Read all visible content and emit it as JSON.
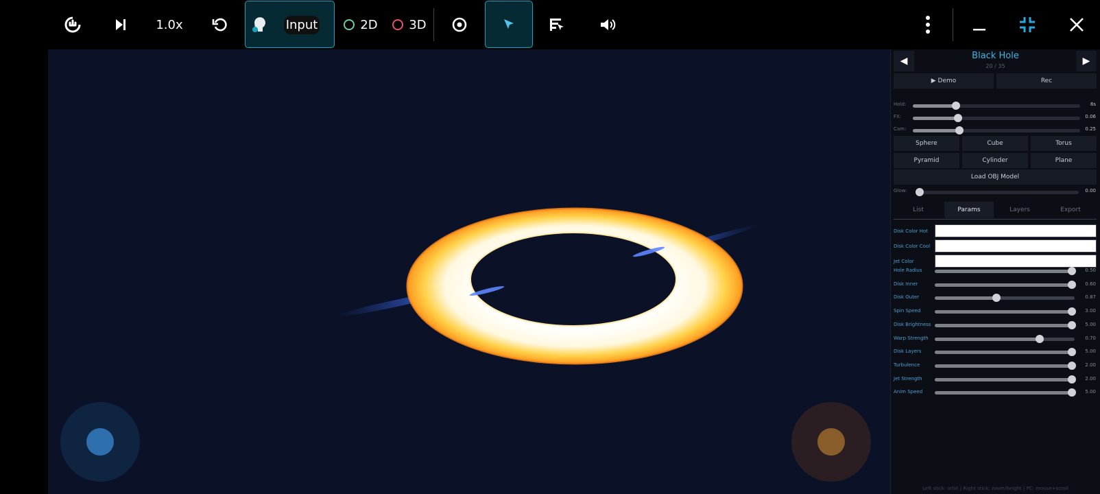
{
  "toolbar": {
    "speed_label": "1.0x",
    "input_label": "Input",
    "mode_2d_label": "2D",
    "mode_3d_label": "3D",
    "colors": {
      "accent": "#17a3c0",
      "ring_2d": "#6fd0a0",
      "ring_3d": "#e2556a"
    }
  },
  "viewport": {
    "left_joystick_color": "#2e6fae",
    "right_joystick_color": "#8a5e2a"
  },
  "panel": {
    "title": "Black Hole",
    "counter": "20 / 35",
    "prev_label": "◀",
    "next_label": "▶",
    "demo_label": "▶ Demo",
    "rec_label": "Rec",
    "top_sliders": [
      {
        "label": "Hold:",
        "value": "8s",
        "level": 0.26
      },
      {
        "label": "FX:",
        "value": "0.06",
        "level": 0.27
      },
      {
        "label": "Cam:",
        "value": "0.25",
        "level": 0.28
      }
    ],
    "shapes": [
      "Sphere",
      "Cube",
      "Torus",
      "Pyramid",
      "Cylinder",
      "Plane"
    ],
    "load_obj_label": "Load OBJ Model",
    "glow": {
      "label": "Glow:",
      "value": "0.00",
      "level": 0.0
    },
    "tabs": [
      {
        "label": "List",
        "active": false
      },
      {
        "label": "Params",
        "active": true
      },
      {
        "label": "Layers",
        "active": false
      },
      {
        "label": "Export",
        "active": false
      }
    ],
    "color_params": [
      {
        "label": "Disk Color Hot"
      },
      {
        "label": "Disk Color Cool"
      },
      {
        "label": "Jet Color"
      }
    ],
    "params": [
      {
        "label": "Hole Radius",
        "value": "0.50",
        "level": 0.98
      },
      {
        "label": "Disk Inner",
        "value": "0.60",
        "level": 0.98
      },
      {
        "label": "Disk Outer",
        "value": "0.87",
        "level": 0.44
      },
      {
        "label": "Spin Speed",
        "value": "3.00",
        "level": 0.98
      },
      {
        "label": "Disk Brightness",
        "value": "5.00",
        "level": 0.98
      },
      {
        "label": "Warp Strength",
        "value": "0.70",
        "level": 0.75
      },
      {
        "label": "Disk Layers",
        "value": "5.00",
        "level": 0.98
      },
      {
        "label": "Turbulence",
        "value": "2.00",
        "level": 0.98
      },
      {
        "label": "Jet Strength",
        "value": "2.00",
        "level": 0.98
      },
      {
        "label": "Anim Speed",
        "value": "5.00",
        "level": 0.98
      }
    ],
    "footer": "Left stick: orbit | Right stick: zoom/height | PC: mouse+scroll"
  }
}
